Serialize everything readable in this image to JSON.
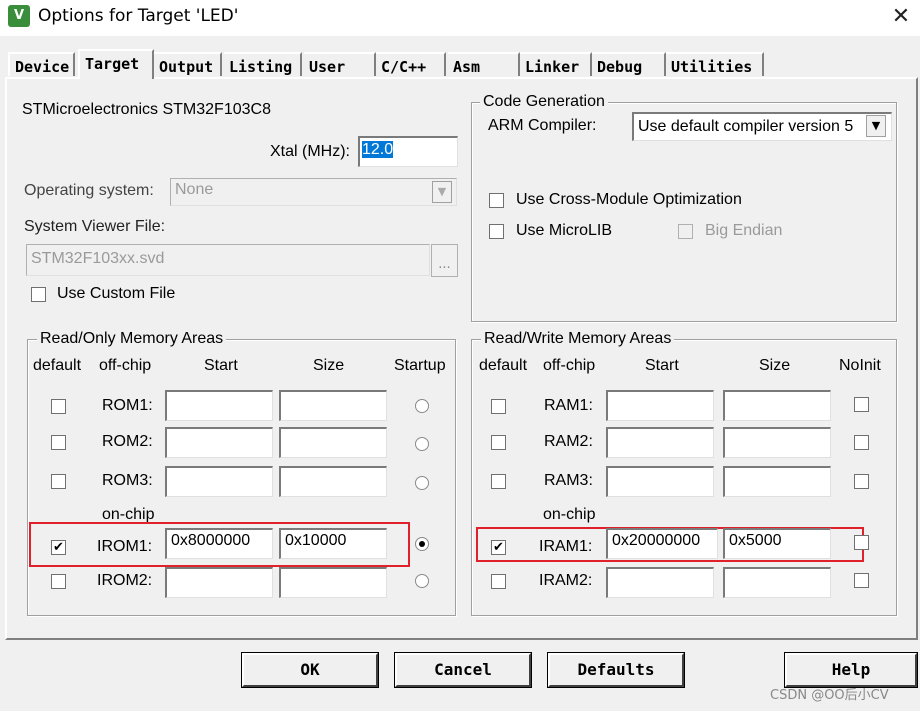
{
  "window": {
    "title": "Options for Target 'LED'",
    "icon": "keil-uv-icon"
  },
  "tabs": [
    "Device",
    "Target",
    "Output",
    "Listing",
    "User",
    "C/C++",
    "Asm",
    "Linker",
    "Debug",
    "Utilities"
  ],
  "active_tab": "Target",
  "device": {
    "name": "STMicroelectronics STM32F103C8",
    "xtal_label": "Xtal (MHz):",
    "xtal_value": "12.0",
    "os_label": "Operating system:",
    "os_value": "None",
    "svd_label": "System Viewer File:",
    "svd_value": "STM32F103xx.svd",
    "svd_browse": "...",
    "custom_file_label": "Use Custom File"
  },
  "code_generation": {
    "title": "Code Generation",
    "compiler_label": "ARM Compiler:",
    "compiler_value": "Use default compiler version 5",
    "cross_module_label": "Use Cross-Module Optimization",
    "microlib_label": "Use MicroLIB",
    "big_endian_label": "Big Endian"
  },
  "rom": {
    "title": "Read/Only Memory Areas",
    "headers": {
      "default": "default",
      "offchip": "off-chip",
      "start": "Start",
      "size": "Size",
      "startup": "Startup"
    },
    "onchip_label": "on-chip",
    "rows": [
      {
        "label": "ROM1:",
        "start": "",
        "size": "",
        "default": false,
        "startup": false
      },
      {
        "label": "ROM2:",
        "start": "",
        "size": "",
        "default": false,
        "startup": false
      },
      {
        "label": "ROM3:",
        "start": "",
        "size": "",
        "default": false,
        "startup": false
      },
      {
        "label": "IROM1:",
        "start": "0x8000000",
        "size": "0x10000",
        "default": true,
        "startup": true
      },
      {
        "label": "IROM2:",
        "start": "",
        "size": "",
        "default": false,
        "startup": false
      }
    ]
  },
  "ram": {
    "title": "Read/Write Memory Areas",
    "headers": {
      "default": "default",
      "offchip": "off-chip",
      "start": "Start",
      "size": "Size",
      "noinit": "NoInit"
    },
    "onchip_label": "on-chip",
    "rows": [
      {
        "label": "RAM1:",
        "start": "",
        "size": "",
        "default": false,
        "noinit": false
      },
      {
        "label": "RAM2:",
        "start": "",
        "size": "",
        "default": false,
        "noinit": false
      },
      {
        "label": "RAM3:",
        "start": "",
        "size": "",
        "default": false,
        "noinit": false
      },
      {
        "label": "IRAM1:",
        "start": "0x20000000",
        "size": "0x5000",
        "default": true,
        "noinit": false
      },
      {
        "label": "IRAM2:",
        "start": "",
        "size": "",
        "default": false,
        "noinit": false
      }
    ]
  },
  "buttons": {
    "ok": "OK",
    "cancel": "Cancel",
    "defaults": "Defaults",
    "help": "Help"
  },
  "watermark": "CSDN @OO后小CV",
  "colors": {
    "highlight": "#e0202a",
    "selection": "#0078d7"
  }
}
